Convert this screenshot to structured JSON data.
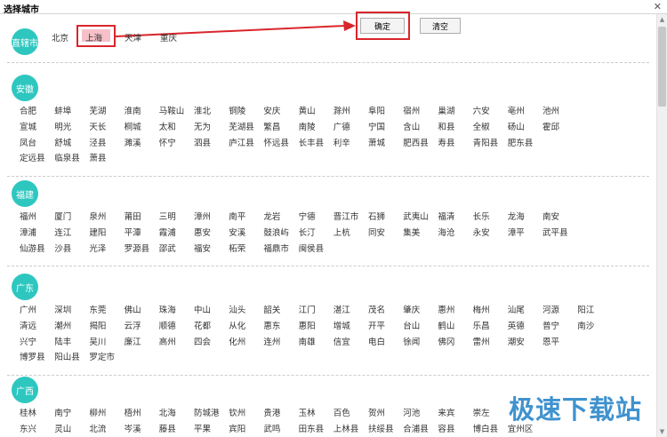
{
  "window": {
    "title": "选择城市",
    "close_glyph": "✕"
  },
  "buttons": {
    "confirm": "确定",
    "clear": "清空"
  },
  "selected_city": "上海",
  "municipalities": {
    "label": "直辖市",
    "cities": [
      "北京",
      "上海",
      "天津",
      "重庆"
    ]
  },
  "provinces": [
    {
      "label": "安徽",
      "rows": [
        [
          "合肥",
          "蚌埠",
          "芜湖",
          "淮南",
          "马鞍山",
          "淮北",
          "铜陵",
          "安庆",
          "黄山",
          "滁州",
          "阜阳",
          "宿州",
          "巢湖",
          "六安",
          "亳州",
          "池州"
        ],
        [
          "宣城",
          "明光",
          "天长",
          "桐城",
          "太和",
          "无为",
          "芜湖县",
          "繁昌",
          "南陵",
          "广德",
          "宁国",
          "含山",
          "和县",
          "全椒",
          "砀山",
          "霍邱"
        ],
        [
          "凤台",
          "舒城",
          "泾县",
          "濉溪",
          "怀宁",
          "泗县",
          "庐江县",
          "怀远县",
          "长丰县",
          "利辛",
          "萧城",
          "肥西县",
          "寿县",
          "青阳县",
          "肥东县"
        ],
        [
          "定远县",
          "临泉县",
          "萧县"
        ]
      ]
    },
    {
      "label": "福建",
      "rows": [
        [
          "福州",
          "厦门",
          "泉州",
          "莆田",
          "三明",
          "漳州",
          "南平",
          "龙岩",
          "宁德",
          "晋江市",
          "石狮",
          "武夷山",
          "福清",
          "长乐",
          "龙海",
          "南安"
        ],
        [
          "漳浦",
          "连江",
          "建阳",
          "平潭",
          "霞浦",
          "惠安",
          "安溪",
          "鼓浪屿",
          "长汀",
          "上杭",
          "同安",
          "集美",
          "海沧",
          "永安",
          "漳平",
          "武平县"
        ],
        [
          "仙游县",
          "沙县",
          "光泽",
          "罗源县",
          "邵武",
          "福安",
          "柘荣",
          "福鼎市",
          "闽侯县"
        ]
      ]
    },
    {
      "label": "广东",
      "rows": [
        [
          "广州",
          "深圳",
          "东莞",
          "佛山",
          "珠海",
          "中山",
          "汕头",
          "韶关",
          "江门",
          "湛江",
          "茂名",
          "肇庆",
          "惠州",
          "梅州",
          "汕尾",
          "河源",
          "阳江"
        ],
        [
          "清远",
          "潮州",
          "揭阳",
          "云浮",
          "顺德",
          "花都",
          "从化",
          "惠东",
          "惠阳",
          "增城",
          "开平",
          "台山",
          "鹤山",
          "乐昌",
          "英德",
          "普宁",
          "南沙"
        ],
        [
          "兴宁",
          "陆丰",
          "吴川",
          "廉江",
          "高州",
          "四会",
          "化州",
          "连州",
          "南雄",
          "信宜",
          "电白",
          "徐闻",
          "佛冈",
          "雷州",
          "潮安",
          "恩平"
        ],
        [
          "博罗县",
          "阳山县",
          "罗定市"
        ]
      ]
    },
    {
      "label": "广西",
      "rows": [
        [
          "桂林",
          "南宁",
          "柳州",
          "梧州",
          "北海",
          "防城港",
          "钦州",
          "贵港",
          "玉林",
          "百色",
          "贺州",
          "河池",
          "来宾",
          "崇左"
        ],
        [
          "东兴",
          "灵山",
          "北流",
          "岑溪",
          "藤县",
          "平果",
          "宾阳",
          "武鸣",
          "田东县",
          "上林县",
          "扶绥县",
          "合浦县",
          "容县",
          "博白县",
          "宜州区"
        ]
      ]
    }
  ],
  "watermark": "极速下载站"
}
